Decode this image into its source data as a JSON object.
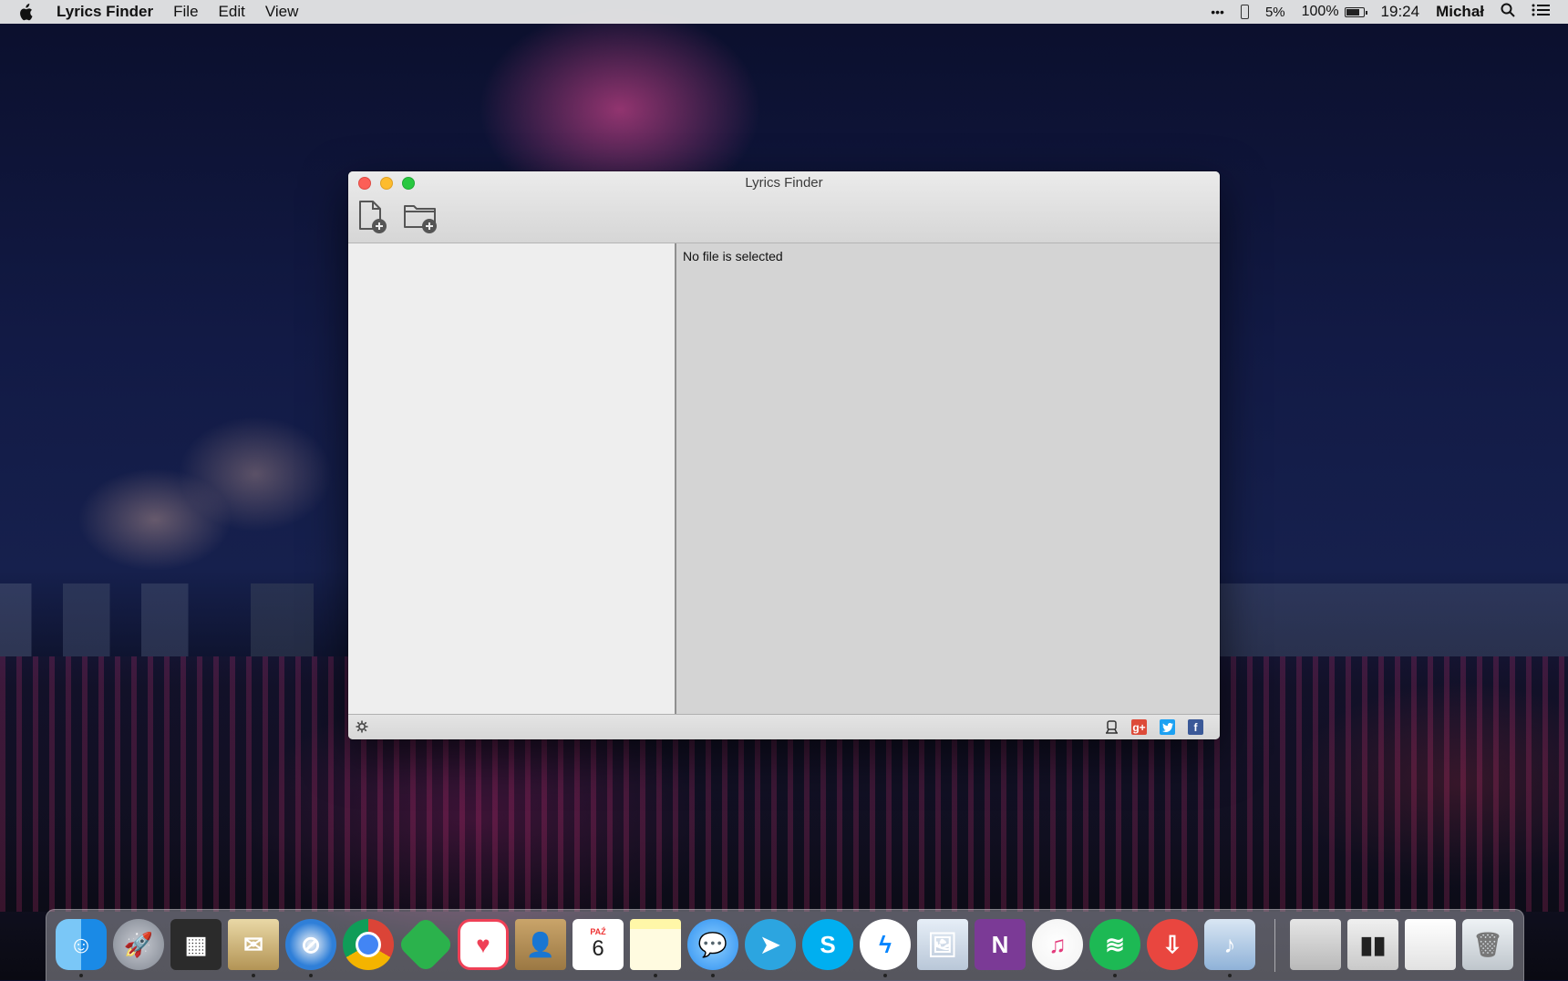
{
  "menubar": {
    "app_name": "Lyrics Finder",
    "menus": [
      "File",
      "Edit",
      "View"
    ],
    "status": {
      "overflow": "•••",
      "phone_battery": "5%",
      "battery": "100%",
      "time": "19:24",
      "user": "Michał"
    }
  },
  "window": {
    "title": "Lyrics Finder",
    "detail_text": "No file is selected",
    "toolbar": {
      "add_file_icon": "add-file-icon",
      "add_folder_icon": "add-folder-icon"
    },
    "footer": {
      "settings_icon": "gear-icon",
      "share_icons": [
        "lyrics-icon",
        "google-plus-icon",
        "twitter-icon",
        "facebook-icon"
      ]
    }
  },
  "calendar_icon": {
    "month": "PAŹ",
    "day": "6"
  },
  "dock": {
    "apps": [
      "Finder",
      "Launchpad",
      "Mission Control",
      "Mail",
      "Safari",
      "Chrome",
      "Feedly",
      "Pocket",
      "Contacts",
      "Calendar",
      "Notes",
      "Messages",
      "Telegram",
      "Skype",
      "Messenger",
      "Preview",
      "OneNote",
      "iTunes",
      "Spotify",
      "Transmit",
      "Lyrics Finder",
      "Downloads",
      "Documents",
      "Screenshots",
      "Trash"
    ]
  },
  "colors": {
    "close": "#fc5f57",
    "minimize": "#fdbc2e",
    "zoom": "#28c840",
    "google_plus": "#dd4b39",
    "twitter": "#1da1f2",
    "facebook": "#3b5998"
  }
}
